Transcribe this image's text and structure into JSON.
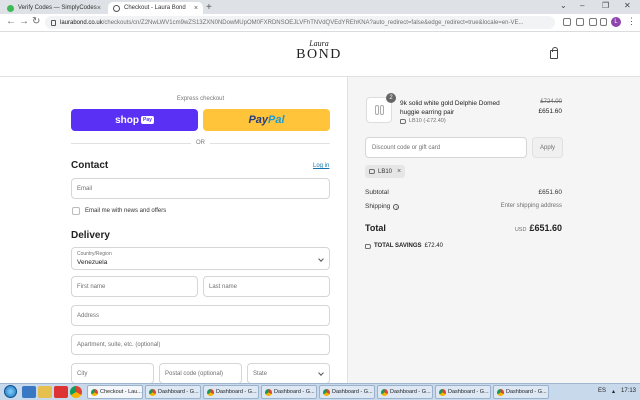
{
  "browser": {
    "tabs": [
      {
        "title": "Verify Codes — SimplyCodes",
        "active": false
      },
      {
        "title": "Checkout - Laura Bond",
        "active": true
      }
    ],
    "url_domain": "laurabond.co.uk",
    "url_path": "/checkouts/cn/Z2NwLWV1cm9wZS13ZXN0NDowMUpOM0FXRDNSOEJLVFhTNVdQVEdYREhKNA?auto_redirect=false&edge_redirect=true&locale=en-VE...",
    "profile_initial": "L"
  },
  "header": {
    "logo_script": "Laura",
    "logo_main": "BOND",
    "bag_icon": "shopping-bag-icon"
  },
  "checkout": {
    "express_label": "Express checkout",
    "shop_pay_label": "shop",
    "shop_pay_badge": "Pay",
    "paypal_part1": "Pay",
    "paypal_part2": "Pal",
    "or_label": "OR",
    "contact_title": "Contact",
    "login_link": "Log in",
    "email_placeholder": "Email",
    "news_label": "Email me with news and offers",
    "delivery_title": "Delivery",
    "country_label": "Country/Region",
    "country_value": "Venezuela",
    "first_name_placeholder": "First name",
    "last_name_placeholder": "Last name",
    "address_placeholder": "Address",
    "apartment_placeholder": "Apartment, suite, etc. (optional)",
    "city_placeholder": "City",
    "postal_placeholder": "Postal code (optional)",
    "state_placeholder": "State"
  },
  "summary": {
    "quantity": "2",
    "product_name": "9k solid white gold Delphie Domed huggie earring pair",
    "product_discount": "LB10 (-£72.40)",
    "old_price": "£724.00",
    "price": "£651.60",
    "discount_placeholder": "Discount code or gift card",
    "apply_label": "Apply",
    "applied_code": "LB10",
    "subtotal_label": "Subtotal",
    "subtotal_value": "£651.60",
    "shipping_label": "Shipping",
    "shipping_value": "Enter shipping address",
    "total_label": "Total",
    "total_currency": "USD",
    "total_value": "£651.60",
    "savings_label": "TOTAL SAVINGS",
    "savings_value": "£72.40"
  },
  "taskbar": {
    "items": [
      "Checkout - Lau...",
      "Dashboard - G...",
      "Dashboard - G...",
      "Dashboard - G...",
      "Dashboard - G...",
      "Dashboard - G...",
      "Dashboard - G...",
      "Dashboard - G..."
    ],
    "lang": "ES",
    "time": "17:13"
  },
  "colors": {
    "shop_pay": "#5a31f4",
    "paypal": "#ffc439",
    "link": "#1773b0"
  }
}
